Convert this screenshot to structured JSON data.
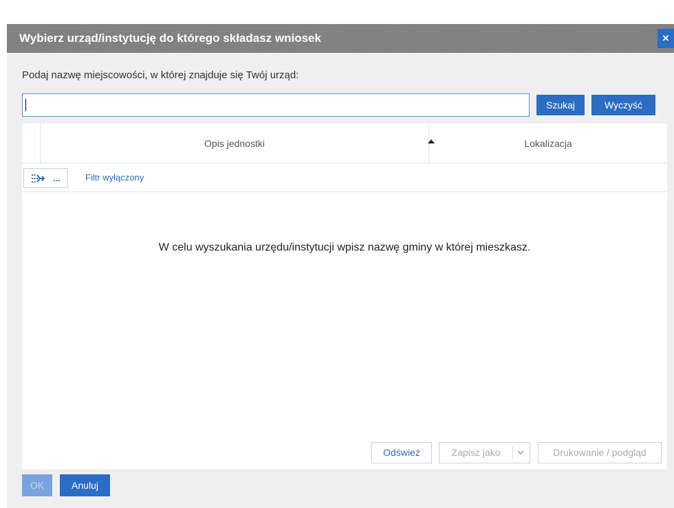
{
  "dialog": {
    "title": "Wybierz urząd/instytucję do którego składasz wniosek",
    "close_label": "×",
    "prompt": "Podaj nazwę miejscowości, w której znajduje się Twój urząd:",
    "search_value": "",
    "search_button": "Szukaj",
    "clear_button": "Wyczyść"
  },
  "grid": {
    "columns": [
      "Opis jednostki",
      "Lokalizacja"
    ],
    "sort": {
      "column": "Opis jednostki",
      "direction": "ascending"
    },
    "filter_dots": "...",
    "filter_label": "Filtr wyłączony",
    "empty_message": "W celu wyszukania urzędu/instytucji wpisz nazwę gminy w której mieszkasz.",
    "refresh_button": "Odśwież",
    "save_as_button": "Zapisz jako",
    "print_button": "Drukowanie / podgląd"
  },
  "footer": {
    "ok_button": "OK",
    "cancel_button": "Anuluj"
  },
  "colors": {
    "accent": "#2b6cc4",
    "titlebar": "#7f7f7f",
    "dialog_bg": "#efefef"
  }
}
